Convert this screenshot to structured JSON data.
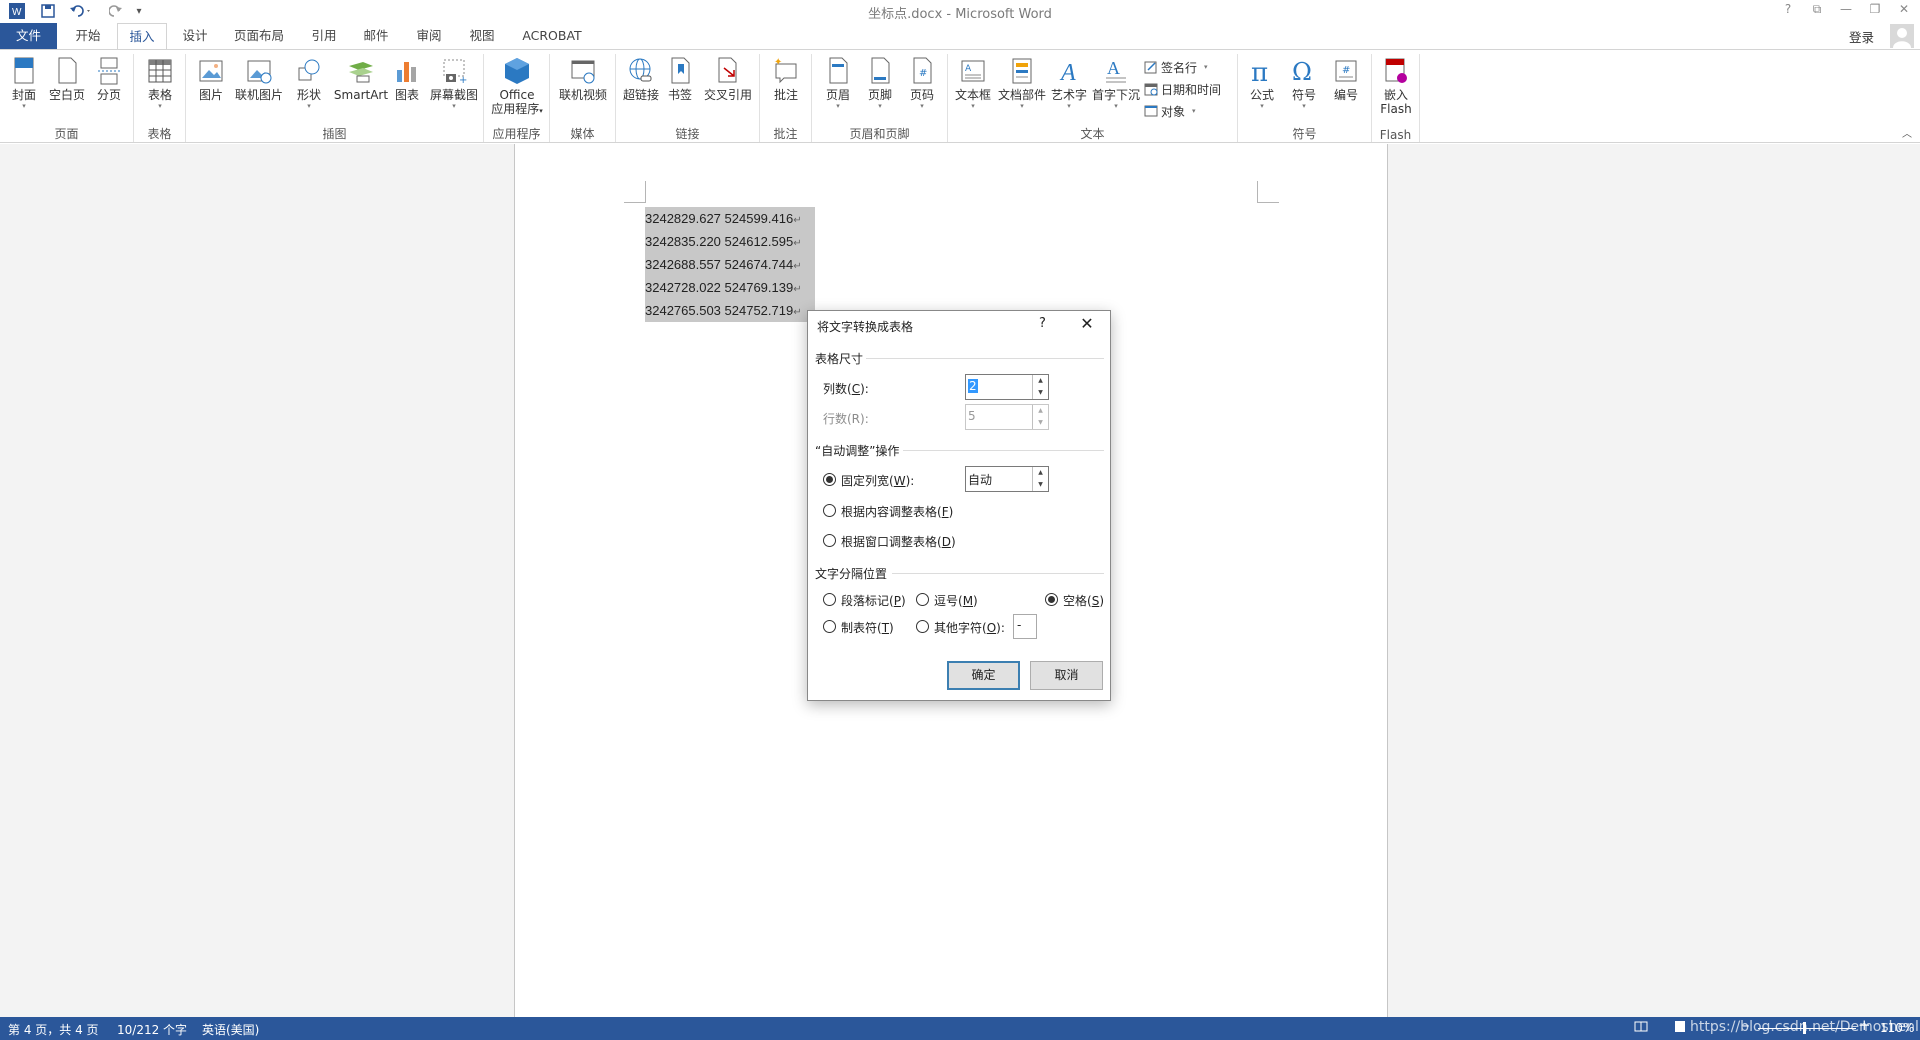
{
  "window": {
    "title": "坐标点.docx - Microsoft Word",
    "help_btn": "?",
    "login": "登录"
  },
  "tabs": [
    {
      "label": "文件"
    },
    {
      "label": "开始"
    },
    {
      "label": "插入"
    },
    {
      "label": "设计"
    },
    {
      "label": "页面布局"
    },
    {
      "label": "引用"
    },
    {
      "label": "邮件"
    },
    {
      "label": "审阅"
    },
    {
      "label": "视图"
    },
    {
      "label": "ACROBAT"
    }
  ],
  "active_tab": "插入",
  "ribbon": {
    "groups": {
      "pages": "页面",
      "tables": "表格",
      "illustrations": "插图",
      "apps": "应用程序",
      "media": "媒体",
      "links": "链接",
      "comments": "批注",
      "header_footer": "页眉和页脚",
      "text": "文本",
      "symbols": "符号",
      "flash": "Flash"
    },
    "buttons": {
      "cover": "封面",
      "blank_page": "空白页",
      "page_break": "分页",
      "table": "表格",
      "pictures": "图片",
      "online_pictures": "联机图片",
      "shapes": "形状",
      "smartart": "SmartArt",
      "chart": "图表",
      "screenshot": "屏幕截图",
      "office_apps_1": "Office",
      "office_apps_2": "应用程序",
      "online_video": "联机视频",
      "hyperlink": "超链接",
      "bookmark": "书签",
      "cross_reference": "交叉引用",
      "comment": "批注",
      "header": "页眉",
      "footer": "页脚",
      "page_number": "页码",
      "text_box": "文本框",
      "quick_parts": "文档部件",
      "wordart": "艺术字",
      "drop_cap": "首字下沉",
      "signature_line": "签名行",
      "date_time": "日期和时间",
      "object": "对象",
      "equation": "公式",
      "symbol": "符号",
      "number": "编号",
      "embed_flash_1": "嵌入",
      "embed_flash_2": "Flash"
    }
  },
  "document": {
    "lines": [
      "3242829.627 524599.416",
      "3242835.220 524612.595",
      "3242688.557 524674.744",
      "3242728.022 524769.139",
      "3242765.503 524752.719"
    ],
    "para_mark": "↵"
  },
  "dialog": {
    "title": "将文字转换成表格",
    "help": "?",
    "close": "✕",
    "section_size": "表格尺寸",
    "columns_label_pre": "列数(",
    "columns_key": "C",
    "columns_label_post": "):",
    "columns_value": "2",
    "rows_label": "行数(R):",
    "rows_value": "5",
    "section_autofit": "“自动调整”操作",
    "fixed_width_pre": "固定列宽(",
    "fixed_width_key": "W",
    "fixed_width_post": "):",
    "fixed_width_value": "自动",
    "autofit_content_pre": "根据内容调整表格(",
    "autofit_content_key": "F",
    "autofit_content_post": ")",
    "autofit_window_pre": "根据窗口调整表格(",
    "autofit_window_key": "D",
    "autofit_window_post": ")",
    "section_separator": "文字分隔位置",
    "sep_paragraph_pre": "段落标记(",
    "sep_paragraph_key": "P",
    "sep_paragraph_post": ")",
    "sep_comma_pre": "逗号(",
    "sep_comma_key": "M",
    "sep_comma_post": ")",
    "sep_space_pre": "空格(",
    "sep_space_key": "S",
    "sep_space_post": ")",
    "sep_tab_pre": "制表符(",
    "sep_tab_key": "T",
    "sep_tab_post": ")",
    "sep_other_pre": "其他字符(",
    "sep_other_key": "O",
    "sep_other_post": "):",
    "sep_other_value": "-",
    "ok": "确定",
    "cancel": "取消"
  },
  "status": {
    "page": "第 4 页，共 4 页",
    "words": "10/212 个字",
    "language": "英语(美国)",
    "watermark": "https://blog.csdn.net/Demoshenli",
    "zoom": "110%"
  },
  "colors": {
    "accent": "#2b579a",
    "selection": "#c8c8c8"
  }
}
